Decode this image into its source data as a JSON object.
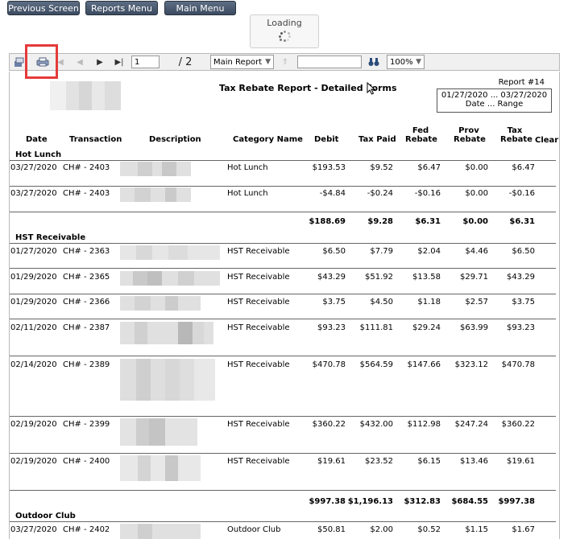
{
  "nav": {
    "previous": "Previous Screen",
    "reports": "Reports Menu",
    "main": "Main Menu"
  },
  "loading": "Loading",
  "toolbar": {
    "page": "1",
    "of_pages": "/ 2",
    "report_select": "Main Report",
    "zoom": "100%",
    "search": ""
  },
  "report": {
    "title": "Tax Rebate Report - Detailed Forms",
    "number": "Report #14",
    "range_dates": "01/27/2020 ... 03/27/2020",
    "range_label": "Date ... Range"
  },
  "columns": {
    "date": "Date",
    "transaction": "Transaction",
    "description": "Description",
    "category": "Category Name",
    "debit": "Debit",
    "tax_paid": "Tax Paid",
    "fed": "Fed Rebate",
    "prov": "Prov Rebate",
    "tax": "Tax Rebate",
    "clear": "Clear"
  },
  "groups": {
    "hot_lunch": {
      "name": "Hot Lunch",
      "rows": [
        {
          "date": "03/27/2020",
          "txn": "CH# - 2403",
          "category": "Hot Lunch",
          "debit": "$193.53",
          "tax_paid": "$9.52",
          "fed": "$6.47",
          "prov": "$0.00",
          "tax": "$6.47"
        },
        {
          "date": "03/27/2020",
          "txn": "CH# - 2403",
          "category": "Hot Lunch",
          "debit": "-$4.84",
          "tax_paid": "-$0.24",
          "fed": "-$0.16",
          "prov": "$0.00",
          "tax": "-$0.16"
        }
      ],
      "total": {
        "debit": "$188.69",
        "tax_paid": "$9.28",
        "fed": "$6.31",
        "prov": "$0.00",
        "tax": "$6.31"
      }
    },
    "hst": {
      "name": "HST Receivable",
      "rows": [
        {
          "date": "01/27/2020",
          "txn": "CH# - 2363",
          "category": "HST Receivable",
          "debit": "$6.50",
          "tax_paid": "$7.79",
          "fed": "$2.04",
          "prov": "$4.46",
          "tax": "$6.50"
        },
        {
          "date": "01/29/2020",
          "txn": "CH# - 2365",
          "category": "HST Receivable",
          "debit": "$43.29",
          "tax_paid": "$51.92",
          "fed": "$13.58",
          "prov": "$29.71",
          "tax": "$43.29"
        },
        {
          "date": "01/29/2020",
          "txn": "CH# - 2366",
          "category": "HST Receivable",
          "debit": "$3.75",
          "tax_paid": "$4.50",
          "fed": "$1.18",
          "prov": "$2.57",
          "tax": "$3.75"
        },
        {
          "date": "02/11/2020",
          "txn": "CH# - 2387",
          "category": "HST Receivable",
          "debit": "$93.23",
          "tax_paid": "$111.81",
          "fed": "$29.24",
          "prov": "$63.99",
          "tax": "$93.23"
        },
        {
          "date": "02/14/2020",
          "txn": "CH# - 2389",
          "category": "HST Receivable",
          "debit": "$470.78",
          "tax_paid": "$564.59",
          "fed": "$147.66",
          "prov": "$323.12",
          "tax": "$470.78"
        },
        {
          "date": "02/19/2020",
          "txn": "CH# - 2399",
          "category": "HST Receivable",
          "debit": "$360.22",
          "tax_paid": "$432.00",
          "fed": "$112.98",
          "prov": "$247.24",
          "tax": "$360.22"
        },
        {
          "date": "02/19/2020",
          "txn": "CH# - 2400",
          "category": "HST Receivable",
          "debit": "$19.61",
          "tax_paid": "$23.52",
          "fed": "$6.15",
          "prov": "$13.46",
          "tax": "$19.61"
        }
      ],
      "total": {
        "debit": "$997.38",
        "tax_paid": "$1,196.13",
        "fed": "$312.83",
        "prov": "$684.55",
        "tax": "$997.38"
      }
    },
    "outdoor": {
      "name": "Outdoor Club",
      "rows": [
        {
          "date": "03/27/2020",
          "txn": "CH# - 2402",
          "category": "Outdoor Club",
          "debit": "$50.81",
          "tax_paid": "$2.00",
          "fed": "$0.52",
          "prov": "$1.15",
          "tax": "$1.67"
        }
      ]
    }
  }
}
